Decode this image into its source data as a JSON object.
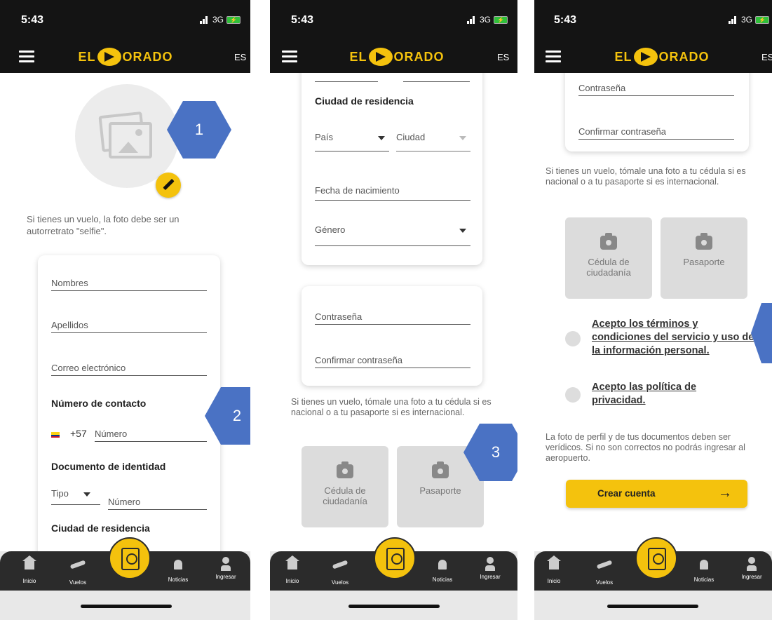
{
  "status_bar": {
    "time": "5:43",
    "network": "3G"
  },
  "app_bar": {
    "logo_left": "EL",
    "logo_right": "ORADO",
    "lang": "ES"
  },
  "screen1": {
    "selfie_note": "Si tienes un vuelo, la foto debe ser un autorretrato \"selfie\".",
    "fields": {
      "names": "Nombres",
      "surnames": "Apellidos",
      "email": "Correo electrónico"
    },
    "contact_title": "Número de contacto",
    "phone_prefix": "+57",
    "phone_placeholder": "Número",
    "id_title": "Documento de identidad",
    "id_type": "Tipo",
    "id_number": "Número",
    "residence_title": "Ciudad de residencia",
    "callouts": [
      "1",
      "2"
    ]
  },
  "screen2": {
    "residence_title": "Ciudad de residencia",
    "country": "País",
    "city": "Ciudad",
    "birth": "Fecha de nacimiento",
    "gender": "Género",
    "password": "Contraseña",
    "confirm_password": "Confirmar contraseña",
    "photo_note": "Si tienes un vuelo, tómale una foto a tu cédula si es nacional o a tu pasaporte si es internacional.",
    "doc_buttons": [
      "Cédula de ciudadanía",
      "Pasaporte"
    ],
    "callout": "3"
  },
  "screen3": {
    "password": "Contraseña",
    "confirm_password": "Confirmar contraseña",
    "photo_note": "Si tienes un vuelo, tómale una foto a tu cédula si es nacional o a tu pasaporte si es internacional.",
    "doc_buttons": [
      "Cédula de ciudadanía",
      "Pasaporte"
    ],
    "terms": "Acepto los términos y condiciones del servicio y uso de la información personal.",
    "privacy": "Acepto las política de privacidad.",
    "warning": "La foto de perfil y de tus documentos deben ser verídicos. Si no son correctos no podrás ingresar al aeropuerto.",
    "create_account": "Crear cuenta",
    "arrow": "→"
  },
  "tabs": [
    "Inicio",
    "Vuelos",
    "Noticias",
    "Ingresar"
  ],
  "colors": {
    "accent": "#f4c20d",
    "bar": "#141414",
    "callout": "#4a72c4"
  }
}
